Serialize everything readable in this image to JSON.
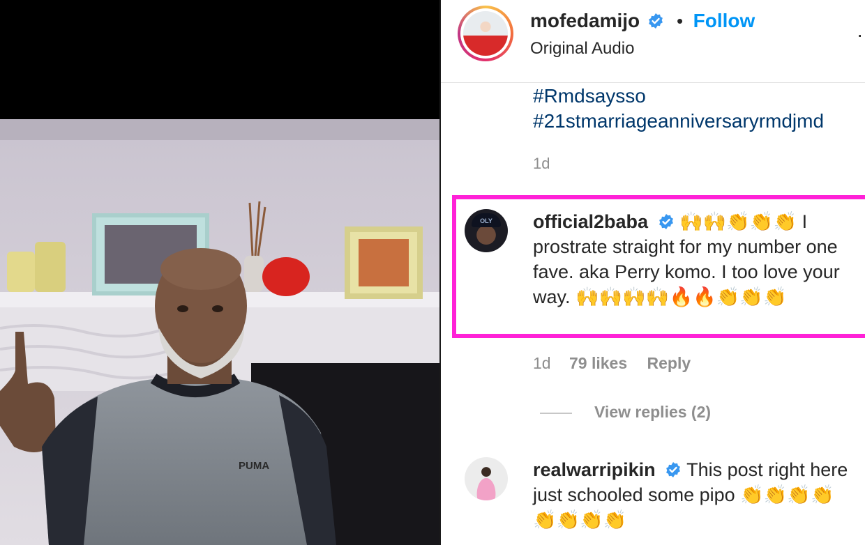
{
  "post": {
    "username": "mofedamijo",
    "follow_label": "Follow",
    "dot": "•",
    "audio": "Original Audio",
    "more": "·",
    "hashtags": [
      "#Rmdsaysso",
      "#21stmarriageanniversaryrmdjmd"
    ],
    "time": "1d"
  },
  "media": {
    "shirt_brand": "PUMA",
    "cap_text": "OLY"
  },
  "comments": [
    {
      "username": "official2baba",
      "text": "🙌🙌👏👏👏 I prostrate straight for my number one fave. aka Perry komo. I too love your way. 🙌🙌🙌🙌🔥🔥👏👏👏",
      "time": "1d",
      "likes": "79 likes",
      "reply_label": "Reply",
      "view_replies": "View replies (2)"
    },
    {
      "username": "realwarripikin",
      "text": "This post right here just schooled some pipo 👏👏👏👏👏👏👏👏"
    }
  ],
  "colors": {
    "follow": "#0095f6",
    "hashtag": "#00376b",
    "highlight": "#ff21d7",
    "muted": "#8e8e8e",
    "verified": "#3897f0"
  }
}
